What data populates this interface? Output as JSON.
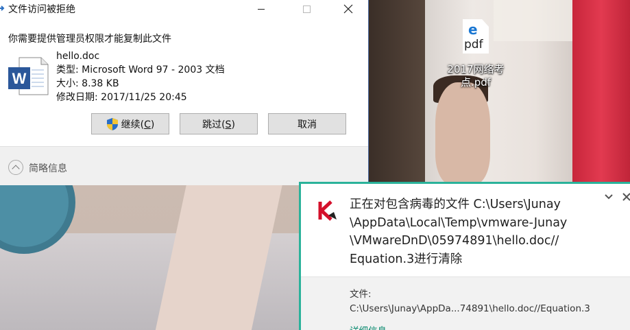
{
  "desktop": {
    "icon_label": "2017网络考点.pdf",
    "icon_badge": "pdf"
  },
  "dialog": {
    "title": "文件访问被拒绝",
    "message": "你需要提供管理员权限才能复制此文件",
    "file_name": "hello.doc",
    "file_type": "类型: Microsoft Word 97 - 2003 文档",
    "file_size": "大小: 8.38 KB",
    "file_modified": "修改日期: 2017/11/25 20:45",
    "continue_label": "继续",
    "continue_key": "(C)",
    "skip_label": "跳过",
    "skip_key": "(S)",
    "cancel_label": "取消",
    "details_toggle": "简略信息"
  },
  "notification": {
    "message_lines": [
      "正在对包含病毒的文件 C:\\Users\\Junay",
      "\\AppData\\Local\\Temp\\vmware-Junay",
      "\\VMwareDnD\\05974891\\hello.doc//",
      "Equation.3进行清除"
    ],
    "file_label": "文件:",
    "file_path": "C:\\Users\\Junay\\AppDa...74891\\hello.doc//Equation.3",
    "details_link": "详细信息",
    "accent_color": "#2ab29a",
    "logo_color": "#d4102b"
  }
}
